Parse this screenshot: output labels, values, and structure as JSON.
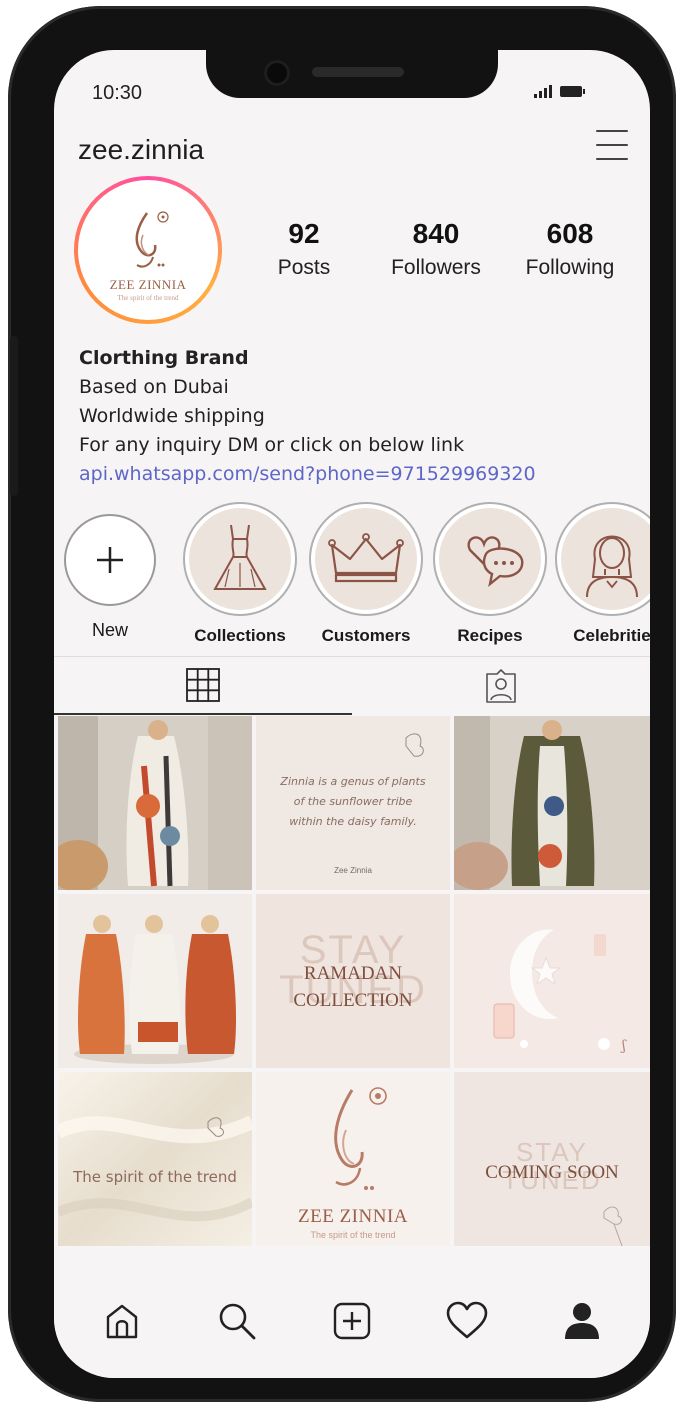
{
  "status": {
    "time": "10:30"
  },
  "profile": {
    "username": "zee.zinnia",
    "avatar_brand": "ZEE ZINNIA",
    "avatar_tagline": "The spirit of the trend",
    "stats": [
      {
        "value": "92",
        "label": "Posts"
      },
      {
        "value": "840",
        "label": "Followers"
      },
      {
        "value": "608",
        "label": "Following"
      }
    ],
    "bio": {
      "title": "Clorthing Brand",
      "lines": [
        "Based on Dubai",
        "Worldwide shipping",
        "For any inquiry DM or click on below link"
      ],
      "link": "api.whatsapp.com/send?phone=971529969320"
    }
  },
  "highlights": [
    {
      "label": "New",
      "icon": "plus-icon"
    },
    {
      "label": "Collections",
      "icon": "dress-icon"
    },
    {
      "label": "Customers",
      "icon": "crown-icon"
    },
    {
      "label": "Recipes",
      "icon": "heart-chat-icon"
    },
    {
      "label": "Celebritie",
      "icon": "woman-portrait-icon"
    }
  ],
  "tabs": [
    {
      "name": "posts-grid",
      "icon": "grid-icon",
      "active": true
    },
    {
      "name": "tagged",
      "icon": "tagged-person-icon",
      "active": false
    }
  ],
  "posts": [
    {
      "kind": "photo",
      "subject": "printed-kaftan-photo"
    },
    {
      "kind": "quote",
      "text_lines": [
        "Zinnia is a genus of plants",
        "of the sunflower tribe",
        "within the daisy family."
      ],
      "footer": "Zee Zinnia"
    },
    {
      "kind": "photo",
      "subject": "green-abaya-photo"
    },
    {
      "kind": "photo",
      "subject": "three-models-photo"
    },
    {
      "kind": "announcement",
      "watermark": [
        "STAY",
        "TUNED"
      ],
      "lines": [
        "RAMADAN",
        "COLLECTION"
      ]
    },
    {
      "kind": "photo",
      "subject": "crescent-moon-lantern-photo"
    },
    {
      "kind": "tagline",
      "text": "The spirit of the trend"
    },
    {
      "kind": "logo",
      "brand": "ZEE ZINNIA",
      "tagline": "The spirit of the trend"
    },
    {
      "kind": "announcement",
      "watermark": [
        "STAY",
        "TUNED"
      ],
      "lines": [
        "COMING SOON"
      ]
    }
  ],
  "bottom_nav": [
    "home-icon",
    "search-icon",
    "add-post-icon",
    "activity-heart-icon",
    "profile-icon"
  ],
  "colors": {
    "link": "#5e66c8",
    "highlight_fill": "#ece3dc",
    "brand_brown": "#9c5e46",
    "ring_start": "#ff4fa0",
    "ring_end": "#ffb040"
  }
}
